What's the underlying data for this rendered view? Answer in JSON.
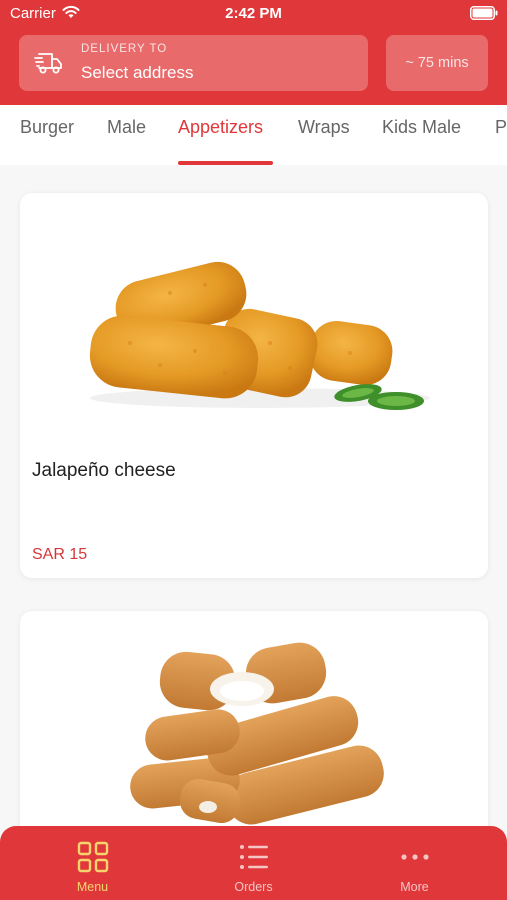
{
  "status_bar": {
    "carrier": "Carrier",
    "time": "2:42 PM",
    "wifi_icon": "wifi-icon",
    "battery_icon": "battery-icon"
  },
  "header": {
    "background_color": "#e0383a",
    "delivery_icon": "truck-icon",
    "delivery_caption": "DELIVERY TO",
    "address_value": "Select address",
    "eta": "~ 75 mins"
  },
  "tabs": [
    {
      "label": "Burger",
      "active": false
    },
    {
      "label": "Male",
      "active": false
    },
    {
      "label": "Appetizers",
      "active": true
    },
    {
      "label": "Wraps",
      "active": false
    },
    {
      "label": "Kids Male",
      "active": false
    },
    {
      "label": "P",
      "active": false
    }
  ],
  "products": [
    {
      "name": "Jalapeño cheese",
      "price": "SAR 15",
      "image": "jalapeno-cheese-bites"
    },
    {
      "name": "",
      "price": "",
      "image": "mozzarella-sticks"
    }
  ],
  "bottom_nav": {
    "active_color": "#f5d46e",
    "items": [
      {
        "label": "Menu",
        "icon": "grid-icon",
        "active": true
      },
      {
        "label": "Orders",
        "icon": "list-icon",
        "active": false
      },
      {
        "label": "More",
        "icon": "more-dots-icon",
        "active": false
      }
    ]
  },
  "accent_color": "#e0383a"
}
